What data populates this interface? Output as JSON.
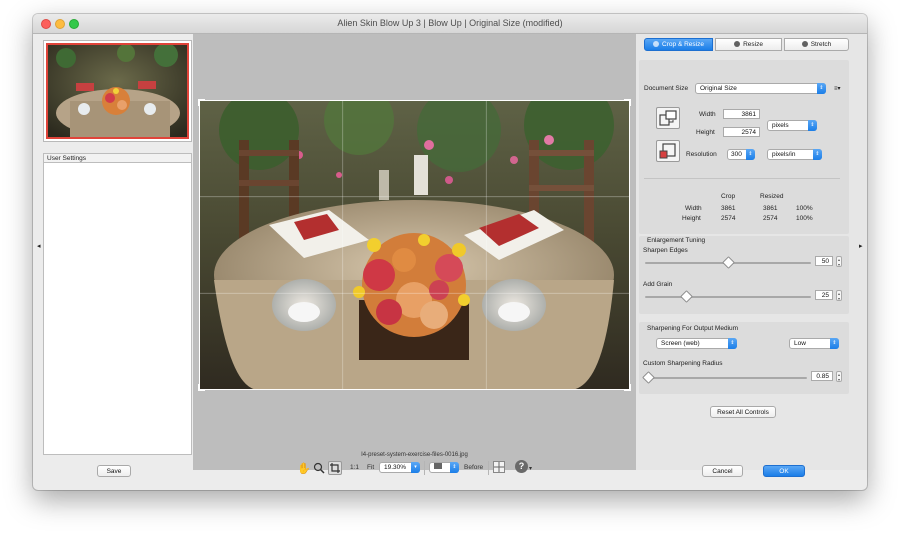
{
  "window": {
    "title": "Alien Skin Blow Up 3 | Blow Up | Original Size (modified)"
  },
  "left_panel": {
    "settings_header": "User Settings"
  },
  "preview": {
    "filename": "I4-preset-system-exercise-files-0016.jpg"
  },
  "tabs": [
    {
      "label": "Crop & Resize",
      "active": true,
      "icon": "crop-icon"
    },
    {
      "label": "Resize",
      "active": false,
      "icon": "resize-icon"
    },
    {
      "label": "Stretch",
      "active": false,
      "icon": "stretch-icon"
    }
  ],
  "document_size": {
    "label": "Document Size",
    "value": "Original Size",
    "menu_icon": "≡▾"
  },
  "dimensions": {
    "width_label": "Width",
    "width_value": "3861",
    "height_label": "Height",
    "height_value": "2574",
    "unit": "pixels",
    "resolution_label": "Resolution",
    "resolution_value": "300",
    "resolution_unit": "pixels/in"
  },
  "size_table": {
    "headers": [
      "Crop",
      "Resized"
    ],
    "rows": [
      {
        "label": "Width",
        "crop": "3861",
        "resized": "3861",
        "percent": "100%"
      },
      {
        "label": "Height",
        "crop": "2574",
        "resized": "2574",
        "percent": "100%"
      }
    ]
  },
  "enlargement": {
    "title": "Enlargement Tuning",
    "sharpen_label": "Sharpen Edges",
    "sharpen_value": "50",
    "sharpen_level": 0.5,
    "grain_label": "Add Grain",
    "grain_value": "25",
    "grain_level": 0.25
  },
  "output_sharpening": {
    "title": "Sharpening For Output Medium",
    "medium": "Screen (web)",
    "amount": "Low",
    "radius_label": "Custom Sharpening Radius",
    "radius_value": "0.85",
    "radius_level": 0.02
  },
  "buttons": {
    "reset": "Reset All Controls",
    "save": "Save",
    "cancel": "Cancel",
    "ok": "OK"
  },
  "toolbar": {
    "one_to_one": "1:1",
    "fit": "Fit",
    "zoom": "19.30%",
    "before": "Before",
    "help": "?"
  },
  "colors": {
    "accent": "#1b7ee8",
    "thumbnail_border": "#e0443a"
  }
}
